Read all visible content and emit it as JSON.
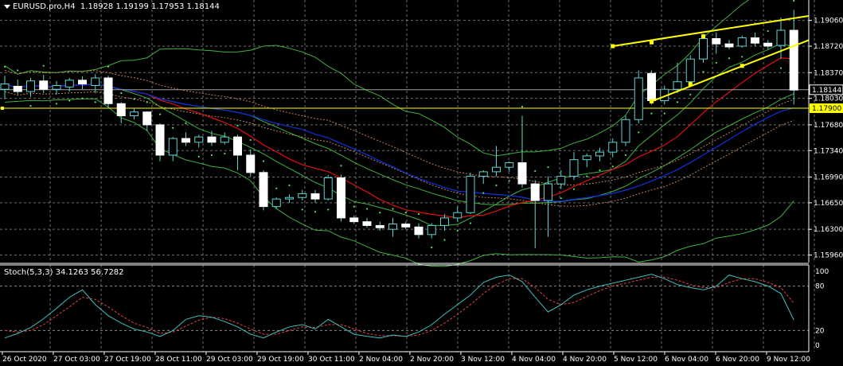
{
  "header": {
    "symbol_label": "EURUSD.pro,H4",
    "ohlc": "1.18928 1.19199 1.17953 1.18144"
  },
  "indicator": {
    "label": "Stoch(5,3,3) 34.1263 56.7282",
    "levels": [
      "100",
      "80",
      "20",
      "0"
    ]
  },
  "price_axis": {
    "ticks": [
      "1.19060",
      "1.18720",
      "1.18370",
      "1.18030",
      "1.17680",
      "1.17340",
      "1.16990",
      "1.16650",
      "1.16300",
      "1.15960"
    ],
    "current_price": "1.18144",
    "line_price": "1.17900"
  },
  "time_axis": {
    "labels": [
      "26 Oct 2020",
      "27 Oct 03:00",
      "27 Oct 19:00",
      "28 Oct 11:00",
      "29 Oct 03:00",
      "29 Oct 19:00",
      "30 Oct 11:00",
      "2 Nov 04:00",
      "2 Nov 20:00",
      "3 Nov 12:00",
      "4 Nov 04:00",
      "4 Nov 20:00",
      "5 Nov 12:00",
      "6 Nov 04:00",
      "6 Nov 20:00",
      "9 Nov 12:00"
    ]
  },
  "colors": {
    "background": "#000000",
    "grid": "#8a8a8a",
    "bull_candle": "#000000",
    "bear_candle": "#ffffff",
    "candle_outline": "#5fd3d3",
    "ma_red": "#e01010",
    "ma_blue": "#1030e0",
    "bands": "#40b040",
    "envelope": "#c08050",
    "psar": "#60e060",
    "trendline": "#ffff00",
    "stoch_main": "#40c0c0",
    "stoch_signal": "#e04040"
  },
  "chart_data": {
    "type": "candlestick",
    "symbol": "EURUSD.pro",
    "timeframe": "H4",
    "ylim": [
      1.1586,
      1.1933
    ],
    "candles": [
      {
        "o": 1.1815,
        "h": 1.1833,
        "l": 1.1802,
        "c": 1.1822
      },
      {
        "o": 1.1819,
        "h": 1.1828,
        "l": 1.1808,
        "c": 1.1812
      },
      {
        "o": 1.1812,
        "h": 1.183,
        "l": 1.1805,
        "c": 1.1826
      },
      {
        "o": 1.1826,
        "h": 1.1834,
        "l": 1.181,
        "c": 1.1815
      },
      {
        "o": 1.1815,
        "h": 1.1826,
        "l": 1.1808,
        "c": 1.182
      },
      {
        "o": 1.1818,
        "h": 1.183,
        "l": 1.1812,
        "c": 1.1827
      },
      {
        "o": 1.1827,
        "h": 1.1832,
        "l": 1.1815,
        "c": 1.1822
      },
      {
        "o": 1.182,
        "h": 1.1835,
        "l": 1.181,
        "c": 1.183
      },
      {
        "o": 1.183,
        "h": 1.1833,
        "l": 1.179,
        "c": 1.1796
      },
      {
        "o": 1.1796,
        "h": 1.1798,
        "l": 1.177,
        "c": 1.178
      },
      {
        "o": 1.178,
        "h": 1.179,
        "l": 1.1775,
        "c": 1.1785
      },
      {
        "o": 1.1785,
        "h": 1.1786,
        "l": 1.176,
        "c": 1.1768
      },
      {
        "o": 1.1768,
        "h": 1.177,
        "l": 1.172,
        "c": 1.1728
      },
      {
        "o": 1.1728,
        "h": 1.1752,
        "l": 1.172,
        "c": 1.175
      },
      {
        "o": 1.175,
        "h": 1.1758,
        "l": 1.174,
        "c": 1.1745
      },
      {
        "o": 1.1745,
        "h": 1.1755,
        "l": 1.1738,
        "c": 1.1752
      },
      {
        "o": 1.1752,
        "h": 1.176,
        "l": 1.174,
        "c": 1.1745
      },
      {
        "o": 1.1745,
        "h": 1.1758,
        "l": 1.1742,
        "c": 1.1752
      },
      {
        "o": 1.1752,
        "h": 1.1755,
        "l": 1.1708,
        "c": 1.1728
      },
      {
        "o": 1.1728,
        "h": 1.1736,
        "l": 1.17,
        "c": 1.1705
      },
      {
        "o": 1.1705,
        "h": 1.1708,
        "l": 1.1655,
        "c": 1.166
      },
      {
        "o": 1.166,
        "h": 1.1672,
        "l": 1.1657,
        "c": 1.167
      },
      {
        "o": 1.167,
        "h": 1.1676,
        "l": 1.1665,
        "c": 1.1672
      },
      {
        "o": 1.1672,
        "h": 1.1682,
        "l": 1.1668,
        "c": 1.1677
      },
      {
        "o": 1.1677,
        "h": 1.1682,
        "l": 1.1665,
        "c": 1.167
      },
      {
        "o": 1.167,
        "h": 1.1702,
        "l": 1.1668,
        "c": 1.1698
      },
      {
        "o": 1.1698,
        "h": 1.1702,
        "l": 1.164,
        "c": 1.1645
      },
      {
        "o": 1.1645,
        "h": 1.1648,
        "l": 1.1637,
        "c": 1.164
      },
      {
        "o": 1.164,
        "h": 1.1645,
        "l": 1.1632,
        "c": 1.1635
      },
      {
        "o": 1.1635,
        "h": 1.164,
        "l": 1.1628,
        "c": 1.1632
      },
      {
        "o": 1.163,
        "h": 1.1645,
        "l": 1.162,
        "c": 1.1637
      },
      {
        "o": 1.1637,
        "h": 1.164,
        "l": 1.163,
        "c": 1.1633
      },
      {
        "o": 1.1633,
        "h": 1.1638,
        "l": 1.1618,
        "c": 1.1623
      },
      {
        "o": 1.1623,
        "h": 1.1638,
        "l": 1.1618,
        "c": 1.1635
      },
      {
        "o": 1.1635,
        "h": 1.165,
        "l": 1.1628,
        "c": 1.1645
      },
      {
        "o": 1.1645,
        "h": 1.166,
        "l": 1.164,
        "c": 1.1652
      },
      {
        "o": 1.1652,
        "h": 1.1705,
        "l": 1.165,
        "c": 1.17
      },
      {
        "o": 1.17,
        "h": 1.1708,
        "l": 1.169,
        "c": 1.1706
      },
      {
        "o": 1.1706,
        "h": 1.174,
        "l": 1.17,
        "c": 1.1712
      },
      {
        "o": 1.1712,
        "h": 1.172,
        "l": 1.1706,
        "c": 1.1718
      },
      {
        "o": 1.1718,
        "h": 1.178,
        "l": 1.1685,
        "c": 1.169
      },
      {
        "o": 1.169,
        "h": 1.1695,
        "l": 1.1605,
        "c": 1.1668
      },
      {
        "o": 1.1668,
        "h": 1.17,
        "l": 1.162,
        "c": 1.169
      },
      {
        "o": 1.169,
        "h": 1.1708,
        "l": 1.1683,
        "c": 1.17
      },
      {
        "o": 1.17,
        "h": 1.1732,
        "l": 1.1695,
        "c": 1.1722
      },
      {
        "o": 1.1722,
        "h": 1.173,
        "l": 1.1712,
        "c": 1.1727
      },
      {
        "o": 1.1727,
        "h": 1.1738,
        "l": 1.172,
        "c": 1.1732
      },
      {
        "o": 1.1732,
        "h": 1.175,
        "l": 1.1725,
        "c": 1.1745
      },
      {
        "o": 1.1745,
        "h": 1.178,
        "l": 1.174,
        "c": 1.1775
      },
      {
        "o": 1.1775,
        "h": 1.184,
        "l": 1.177,
        "c": 1.183
      },
      {
        "o": 1.1836,
        "h": 1.184,
        "l": 1.1795,
        "c": 1.18
      },
      {
        "o": 1.18,
        "h": 1.182,
        "l": 1.1795,
        "c": 1.1815
      },
      {
        "o": 1.1815,
        "h": 1.185,
        "l": 1.181,
        "c": 1.1825
      },
      {
        "o": 1.1825,
        "h": 1.186,
        "l": 1.182,
        "c": 1.1855
      },
      {
        "o": 1.1855,
        "h": 1.1888,
        "l": 1.185,
        "c": 1.1882
      },
      {
        "o": 1.1882,
        "h": 1.189,
        "l": 1.1862,
        "c": 1.1875
      },
      {
        "o": 1.1875,
        "h": 1.188,
        "l": 1.1868,
        "c": 1.1871
      },
      {
        "o": 1.1872,
        "h": 1.1886,
        "l": 1.187,
        "c": 1.1883
      },
      {
        "o": 1.1883,
        "h": 1.189,
        "l": 1.1872,
        "c": 1.1876
      },
      {
        "o": 1.1876,
        "h": 1.188,
        "l": 1.1868,
        "c": 1.1872
      },
      {
        "o": 1.1873,
        "h": 1.191,
        "l": 1.1855,
        "c": 1.1893
      },
      {
        "o": 1.1893,
        "h": 1.192,
        "l": 1.1795,
        "c": 1.1814
      }
    ],
    "stochastic": {
      "main": [
        10,
        16,
        24,
        36,
        50,
        65,
        75,
        55,
        40,
        30,
        22,
        18,
        12,
        20,
        35,
        40,
        38,
        32,
        25,
        15,
        10,
        18,
        25,
        28,
        22,
        35,
        25,
        15,
        12,
        10,
        14,
        12,
        18,
        28,
        42,
        55,
        68,
        85,
        92,
        95,
        86,
        65,
        45,
        55,
        68,
        75,
        80,
        84,
        88,
        92,
        96,
        90,
        82,
        78,
        75,
        80,
        95,
        90,
        86,
        80,
        70,
        34
      ],
      "signal": [
        20,
        18,
        20,
        28,
        40,
        52,
        65,
        62,
        52,
        40,
        30,
        24,
        16,
        18,
        26,
        34,
        38,
        36,
        30,
        22,
        15,
        15,
        20,
        25,
        24,
        28,
        28,
        22,
        16,
        13,
        13,
        12,
        14,
        20,
        30,
        42,
        55,
        70,
        82,
        90,
        90,
        78,
        62,
        55,
        58,
        66,
        74,
        80,
        84,
        88,
        92,
        92,
        88,
        82,
        78,
        78,
        85,
        90,
        90,
        85,
        78,
        57
      ]
    }
  }
}
